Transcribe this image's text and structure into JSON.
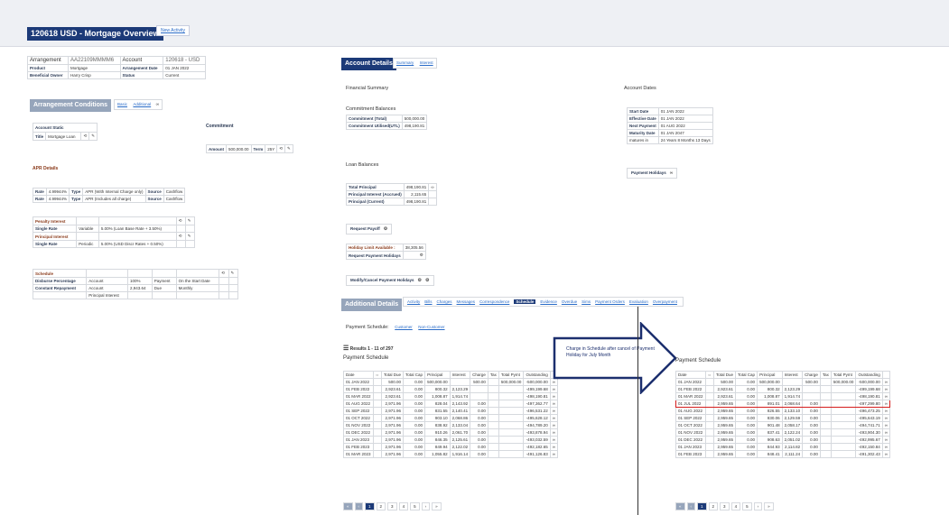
{
  "header": {
    "title": "120618 USD - Mortgage Overview",
    "new_activity": "New Activity"
  },
  "arrangement": {
    "rows": [
      [
        "Arrangement",
        "AA22109MMMM6",
        "Account",
        "120618 - USD"
      ],
      [
        "Product",
        "Mortgage",
        "Arrangement Date",
        "01 JAN 2022"
      ],
      [
        "Beneficial Owner",
        "Harry Crisp",
        "Status",
        "Current"
      ]
    ]
  },
  "conditions": {
    "title": "Arrangement Conditions",
    "tabs": [
      "Basic",
      "Additional"
    ],
    "account_static": "Account Static",
    "title_label": "Title",
    "title_value": "Mortgage Loan",
    "commitment": "Commitment",
    "amount_label": "Amount",
    "amount_value": "500,000.00",
    "term_label": "Term",
    "term_value": "25Y",
    "apr_details": "APR Details",
    "apr_rows": [
      [
        "Rate",
        "4.99944%",
        "Type",
        "APR (With Internal Charge only)",
        "Source",
        "Cashflow"
      ],
      [
        "Rate",
        "4.99944%",
        "Type",
        "APR (Includes all charge)",
        "Source",
        "Cashflow"
      ]
    ],
    "interest_rows": [
      [
        "Penalty Interest",
        "",
        ""
      ],
      [
        "Single Rate",
        "Variable",
        "5.00% (Loan Base Rate + 3.50%)"
      ],
      [
        "Principal Interest",
        "",
        ""
      ],
      [
        "Single Rate",
        "Periodic",
        "5.00% (USD Discr Rates + 0.50%)"
      ]
    ],
    "schedule_rows": [
      [
        "Schedule",
        "",
        "",
        "",
        ""
      ],
      [
        "Disburse Percentage",
        "Account",
        "100%",
        "Payment",
        "On the Start Date"
      ],
      [
        "Constant Repayment",
        "Account",
        "2,943.64",
        "Due",
        "Monthly"
      ],
      [
        "",
        "Principal Interest",
        "",
        "",
        ""
      ]
    ]
  },
  "account_details": {
    "title": "Account Details",
    "tabs": [
      "Summary",
      "Interest"
    ],
    "financial_summary": "Financial Summary",
    "commitment_balances": "Commitment Balances",
    "commitment_rows": [
      [
        "Commitment (Total)",
        "500,000.00"
      ],
      [
        "Commitment Utilised(UTL)",
        "498,190.81"
      ]
    ],
    "loan_balances": "Loan Balances",
    "loan_rows": [
      [
        "Total Principal",
        "498,190.81"
      ],
      [
        "Principal Interest (Accrued)",
        "2,115.65"
      ],
      [
        "Principal (Current)",
        "498,190.81"
      ]
    ],
    "request_payoff": "Request Payoff",
    "holiday_limit": "Holiday Limit Available :",
    "holiday_limit_value": "38,305.56",
    "request_holidays": "Request Payment Holidays",
    "modify_holidays": "Modify/Cancel Payment Holidays",
    "account_dates": "Account Dates",
    "dates_rows": [
      [
        "Start Date",
        "01 JAN 2022"
      ],
      [
        "Effective Date",
        "01 JAN 2022"
      ],
      [
        "Next Payment",
        "01 AUG 2022"
      ],
      [
        "Maturity Date",
        "01 JAN 2047"
      ],
      [
        "matures in",
        "24 Years 8 Months 13 Days"
      ]
    ],
    "payment_holidays": "Payment Holidays"
  },
  "additional": {
    "title": "Additional Details",
    "tabs": [
      "Activity",
      "Bills",
      "Charges",
      "Messages",
      "Correspondence",
      "Schedule",
      "Evidence",
      "Overdue",
      "Sims",
      "Payment Orders",
      "Evaluation",
      "Overpayment"
    ],
    "payment_schedule_label": "Payment Schedule:",
    "customer": "Customer",
    "non_customer": "Non-Customer",
    "results": "Results 1 - 11 of 297",
    "schedule_title": "Payment Schedule",
    "columns": [
      "Date",
      "",
      "Total Due",
      "Total Cap",
      "Principal",
      "Interest",
      "Charge",
      "Tax",
      "Total Pymt",
      "Outstanding",
      ""
    ],
    "rows_before": [
      [
        "01 JAN 2022",
        "500.00",
        "0.00",
        "500,000.00",
        "",
        "500.00",
        "",
        "500,000.00",
        "-500,000.00"
      ],
      [
        "01 FEB 2022",
        "2,923.61",
        "0.00",
        "800.32",
        "2,123.29",
        "",
        "",
        "",
        "-499,199.68"
      ],
      [
        "01 MAR 2022",
        "2,923.61",
        "0.00",
        "1,008.87",
        "1,914.74",
        "",
        "",
        "",
        "-498,190.81"
      ],
      [
        "01 AUG 2022",
        "2,971.96",
        "0.00",
        "828.04",
        "2,143.92",
        "0.00",
        "",
        "",
        "-497,362.77"
      ],
      [
        "01 SEP 2022",
        "2,971.96",
        "0.00",
        "831.55",
        "2,140.41",
        "0.00",
        "",
        "",
        "-496,531.22"
      ],
      [
        "01 OCT 2022",
        "2,971.96",
        "0.00",
        "903.10",
        "2,068.86",
        "0.00",
        "",
        "",
        "-495,628.12"
      ],
      [
        "01 NOV 2022",
        "2,971.96",
        "0.00",
        "838.92",
        "2,133.04",
        "0.00",
        "",
        "",
        "-494,789.20"
      ],
      [
        "01 DEC 2022",
        "2,971.96",
        "0.00",
        "910.26",
        "2,061.70",
        "0.00",
        "",
        "",
        "-493,878.94"
      ],
      [
        "01 JAN 2023",
        "2,971.96",
        "0.00",
        "846.35",
        "2,125.61",
        "0.00",
        "",
        "",
        "-493,032.59"
      ],
      [
        "01 FEB 2023",
        "2,971.96",
        "0.00",
        "849.94",
        "2,122.02",
        "0.00",
        "",
        "",
        "-492,182.65"
      ],
      [
        "01 MAR 2023",
        "2,971.96",
        "0.00",
        "1,055.82",
        "1,916.14",
        "0.00",
        "",
        "",
        "-491,126.83"
      ]
    ],
    "rows_after": [
      [
        "01 JAN 2022",
        "500.00",
        "0.00",
        "500,000.00",
        "",
        "500.00",
        "",
        "500,000.00",
        "-500,000.00"
      ],
      [
        "01 FEB 2022",
        "2,923.61",
        "0.00",
        "800.32",
        "2,123.29",
        "",
        "",
        "",
        "-499,199.68"
      ],
      [
        "01 MAR 2022",
        "2,923.61",
        "0.00",
        "1,008.87",
        "1,914.74",
        "",
        "",
        "",
        "-498,190.81"
      ],
      [
        "01 JUL 2022",
        "2,959.65",
        "0.00",
        "891.01",
        "2,068.64",
        "0.00",
        "",
        "",
        "-497,299.80"
      ],
      [
        "01 AUG 2022",
        "2,959.65",
        "0.00",
        "826.55",
        "2,133.10",
        "0.00",
        "",
        "",
        "-496,473.25"
      ],
      [
        "01 SEP 2022",
        "2,959.65",
        "0.00",
        "830.06",
        "2,129.59",
        "0.00",
        "",
        "",
        "-495,643.19"
      ],
      [
        "01 OCT 2022",
        "2,959.65",
        "0.00",
        "901.48",
        "2,058.17",
        "0.00",
        "",
        "",
        "-494,741.71"
      ],
      [
        "01 NOV 2022",
        "2,959.65",
        "0.00",
        "837.41",
        "2,122.24",
        "0.00",
        "",
        "",
        "-493,904.30"
      ],
      [
        "01 DEC 2022",
        "2,959.65",
        "0.00",
        "908.63",
        "2,051.02",
        "0.00",
        "",
        "",
        "-492,995.67"
      ],
      [
        "01 JAN 2023",
        "2,959.65",
        "0.00",
        "844.93",
        "2,114.82",
        "0.00",
        "",
        "",
        "-492,150.84"
      ],
      [
        "01 FEB 2023",
        "2,959.65",
        "0.00",
        "848.41",
        "2,111.24",
        "0.00",
        "",
        "",
        "-491,302.43"
      ]
    ],
    "pages": [
      "1",
      "2",
      "3",
      "4",
      "5"
    ]
  },
  "annotation": {
    "text": "Charge in Schedule after cancel of Payment Holiday for July Month",
    "after_title": "Payment Schedule"
  }
}
